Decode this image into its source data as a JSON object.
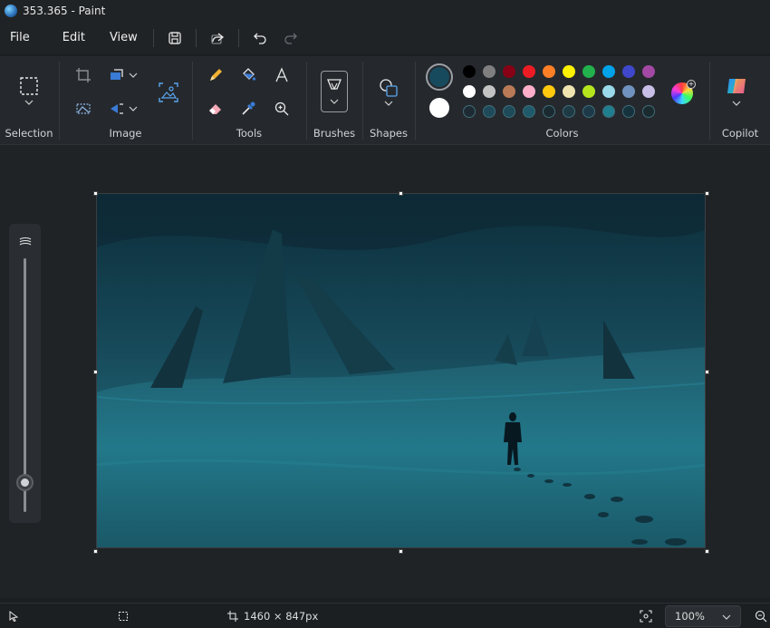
{
  "window": {
    "title": "353.365 - Paint"
  },
  "menu": {
    "file": "File",
    "edit": "Edit",
    "view": "View"
  },
  "quick_actions": [
    "save-icon",
    "share-icon",
    "undo-icon",
    "redo-icon"
  ],
  "ribbon": {
    "selection_label": "Selection",
    "image_label": "Image",
    "tools_label": "Tools",
    "brushes_label": "Brushes",
    "shapes_label": "Shapes",
    "colors_label": "Colors",
    "copilot_label": "Copilot"
  },
  "colors": {
    "primary": "#174a5c",
    "secondary": "#ffffff",
    "row1": [
      "#000000",
      "#7f7f7f",
      "#880015",
      "#ed1c24",
      "#ff7f27",
      "#fff200",
      "#22b14c",
      "#00a2e8",
      "#3f48cc",
      "#a349a4"
    ],
    "row2": [
      "#ffffff",
      "#c3c3c3",
      "#b97a57",
      "#ffaec9",
      "#ffc90e",
      "#efe4b0",
      "#b5e61d",
      "#99d9ea",
      "#7092be",
      "#c8bfe7"
    ],
    "row3": [
      "#1e2a33",
      "#1e4a5a",
      "#1e4a5a",
      "#1f5a6a",
      "#1a2a30",
      "#1e3a44",
      "#1e3a48",
      "#1f7f8f",
      "#16323c",
      "#1a2a2e"
    ]
  },
  "status": {
    "canvas_size": "1460 × 847px",
    "zoom": "100%"
  }
}
